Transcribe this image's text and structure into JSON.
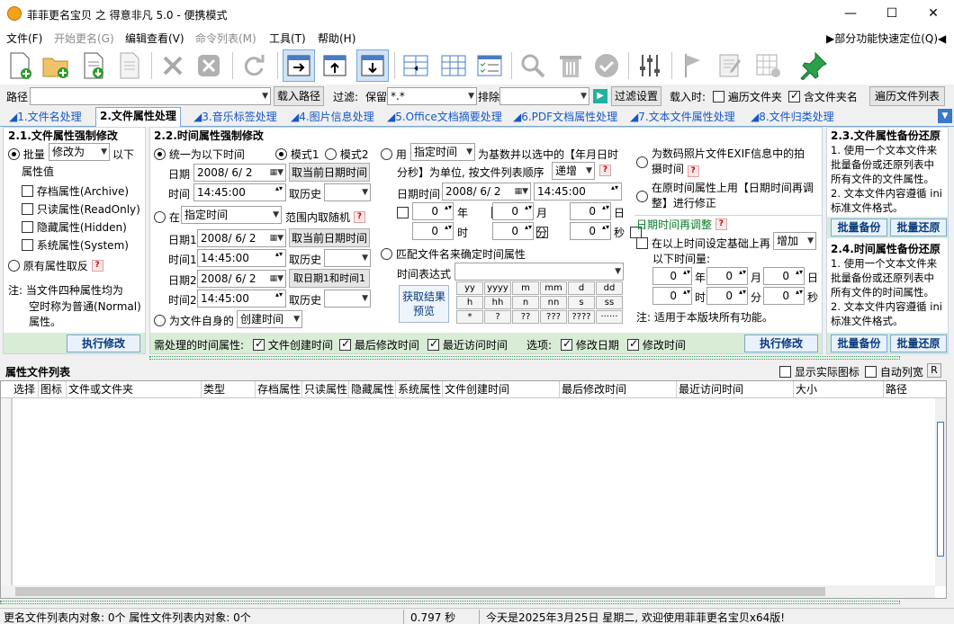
{
  "window": {
    "title": "菲菲更名宝贝 之 得意非凡 5.0 - 便携模式",
    "minimize": "—",
    "maximize": "☐",
    "close": "✕"
  },
  "menu": {
    "items": [
      "文件(F)",
      "开始更名(G)",
      "编辑查看(V)",
      "命令列表(M)",
      "工具(T)",
      "帮助(H)"
    ],
    "quick": "▶部分功能快速定位(Q)◀"
  },
  "path": {
    "label": "路径",
    "value": "",
    "load_btn": "载入路径",
    "filter_label": "过滤:",
    "keep_label": "保留",
    "keep_value": "*.*",
    "exclude_label": "排除",
    "exclude_value": "",
    "filter_btn": "过滤设置",
    "load_when": "载入时:",
    "traverse_folder": "遍历文件夹",
    "include_folder_names": "含文件夹名",
    "traverse_list_btn": "遍历文件列表"
  },
  "tabs": [
    "1.文件名处理",
    "2.文件属性处理",
    "3.音乐标签处理",
    "4.图片信息处理",
    "5.Office文档摘要处理",
    "6.PDF文档属性处理",
    "7.文本文件属性处理",
    "8.文件归类处理"
  ],
  "sec21": {
    "title": "2.1.文件属性强制修改",
    "batch": "批量",
    "mode": "修改为",
    "mode_suffix": "以下",
    "attr_value": "属性值",
    "archive": "存档属性(Archive)",
    "readonly": "只读属性(ReadOnly)",
    "hidden": "隐藏属性(Hidden)",
    "system": "系统属性(System)",
    "invert": "原有属性取反",
    "note1": "注: 当文件四种属性均为",
    "note2": "空时称为普通(Normal)",
    "note3": "属性。",
    "exec": "执行修改"
  },
  "sec22": {
    "title": "2.2.时间属性强制修改",
    "unify": "统一为以下时间",
    "mode1": "模式1",
    "mode2": "模式2",
    "date_label": "日期",
    "date_val": "2008/ 6/ 2",
    "time_label": "时间",
    "time_val": "14:45:00",
    "now_btn": "取当前日期时间",
    "hist": "取历史",
    "in_label": "在",
    "in_val": "指定时间",
    "random_label": "范围内取随机",
    "date1": "日期1",
    "time1": "时间1",
    "date2": "日期2",
    "time2": "时间2",
    "d12_btn": "取日期1和时间1",
    "self_label": "为文件自身的",
    "self_val": "创建时间",
    "use_label": "用",
    "use_val": "指定时间",
    "base_text": "为基数并以选中的【年月日时",
    "base_text2": "分秒】为单位, 按文件列表顺序",
    "order": "递增",
    "datetime_label": "日期时间",
    "year": "年",
    "month": "月",
    "day": "日",
    "hour": "时",
    "minute": "分",
    "second": "秒",
    "zero": "0",
    "match_label": "匹配文件名来确定时间属性",
    "expr_label": "时间表达式",
    "preview_btn": "获取结果预览",
    "tokens": [
      "yy",
      "yyyy",
      "m",
      "mm",
      "d",
      "dd",
      "h",
      "hh",
      "n",
      "nn",
      "s",
      "ss",
      "*",
      "?",
      "??",
      "???",
      "????",
      "······"
    ],
    "exif": "为数码照片文件EXIF信息中的拍摄时间",
    "fix": "在原时间属性上用【日期时间再调整】进行修正",
    "adjust_title": "日期时间再调整",
    "adjust_on": "在以上时间设定基础上再",
    "adjust_mode": "增加",
    "adjust_amount": "以下时间量:",
    "note": "注: 适用于本版块所有功能。",
    "need_label": "需处理的时间属性:",
    "created": "文件创建时间",
    "modified": "最后修改时间",
    "accessed": "最近访问时间",
    "options": "选项:",
    "mod_date": "修改日期",
    "mod_time": "修改时间",
    "exec": "执行修改"
  },
  "sec23": {
    "title": "2.3.文件属性备份还原",
    "l1": "1. 使用一个文本文件来",
    "l2": "批量备份或还原列表中",
    "l3": "所有文件的文件属性。",
    "l4": "2. 文本文件内容遵循 ini",
    "l5": "标准文件格式。",
    "backup": "批量备份",
    "restore": "批量还原"
  },
  "sec24": {
    "title": "2.4.时间属性备份还原",
    "l1": "1. 使用一个文本文件来",
    "l2": "批量备份或还原列表中",
    "l3": "所有文件的时间属性。",
    "l4": "2. 文本文件内容遵循 ini",
    "l5": "标准文件格式。",
    "backup": "批量备份",
    "restore": "批量还原"
  },
  "list": {
    "title": "属性文件列表",
    "show_icons": "显示实际图标",
    "auto_width": "自动列宽",
    "r": "R",
    "columns": [
      "选择",
      "图标",
      "文件或文件夹",
      "类型",
      "存档属性",
      "只读属性",
      "隐藏属性",
      "系统属性",
      "文件创建时间",
      "最后修改时间",
      "最近访问时间",
      "大小",
      "路径"
    ]
  },
  "status": {
    "left": "更名文件列表内对象: 0个   属性文件列表内对象: 0个",
    "time": "0.797 秒",
    "msg": "今天是2025年3月25日 星期二, 欢迎使用菲菲更名宝贝x64版!"
  }
}
